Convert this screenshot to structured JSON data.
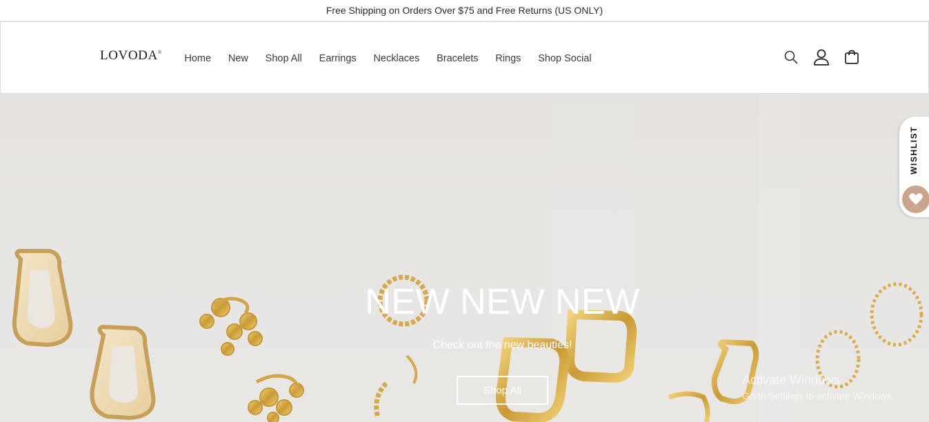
{
  "announcement": {
    "text": "Free Shipping on Orders Over $75 and Free Returns (US ONLY)"
  },
  "header": {
    "logo": "LOVODA",
    "logo_mark": "®",
    "nav": [
      "Home",
      "New",
      "Shop All",
      "Earrings",
      "Necklaces",
      "Bracelets",
      "Rings",
      "Shop Social"
    ],
    "icons": [
      "search-icon",
      "account-icon",
      "cart-icon"
    ]
  },
  "hero": {
    "title": "NEW NEW NEW",
    "subtitle": "Check out the new beauties!",
    "button": "Shop All"
  },
  "wishlist": {
    "label": "WISHLIST",
    "icon": "heart-icon"
  },
  "watermark": {
    "line1": "Activate Windows",
    "line2": "Go to Settings to activate Windows."
  },
  "colors": {
    "accent": "#c8a58c",
    "gold": "#d9ad4c"
  }
}
